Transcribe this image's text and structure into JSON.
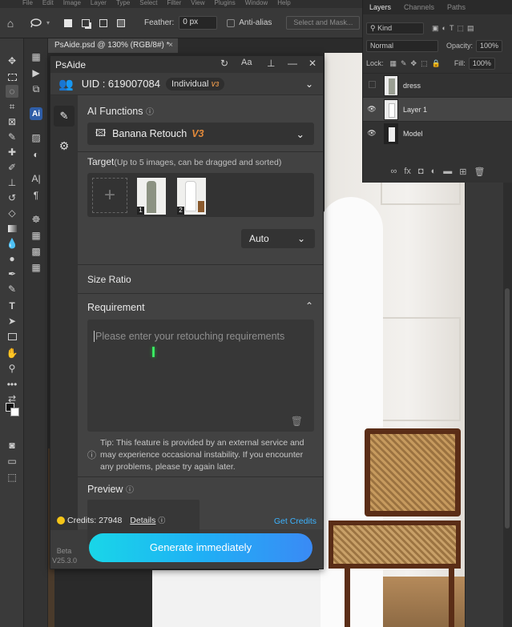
{
  "menubar": {
    "items": [
      "File",
      "Edit",
      "Image",
      "Layer",
      "Type",
      "Select",
      "Filter",
      "View",
      "Plugins",
      "Window",
      "Help"
    ]
  },
  "options": {
    "feather_label": "Feather:",
    "feather_value": "0 px",
    "antialias_label": "Anti-alias",
    "select_mask": "Select and Mask..."
  },
  "document": {
    "tab_title": "PsAide.psd @ 130% (RGB/8#) *"
  },
  "layers_panel": {
    "tabs": [
      "Layers",
      "Channels",
      "Paths"
    ],
    "kind": "Kind",
    "blend": "Normal",
    "opacity_label": "Opacity:",
    "opacity": "100%",
    "lock_label": "Lock:",
    "fill_label": "Fill:",
    "fill": "100%",
    "layers": [
      {
        "name": "dress"
      },
      {
        "name": "Layer 1"
      },
      {
        "name": "Model"
      }
    ]
  },
  "psaide": {
    "title": "PsAide",
    "uid": "UID : 619007084",
    "badge": "Individual",
    "badge_v": "V3",
    "ai_functions_label": "AI Functions",
    "function": "Banana Retouch",
    "function_version": "V3",
    "target_label": "Target",
    "target_hint": "(Up to 5 images, can be dragged and sorted)",
    "target_images": [
      "1",
      "2"
    ],
    "size_ratio_label": "Size Ratio",
    "size_ratio_value": "Auto",
    "requirement_label": "Requirement",
    "requirement_placeholder": "Please enter your retouching requirements",
    "tip": "Tip: This feature is provided by an external service and may experience occasional instability. If you encounter any problems, please try again later.",
    "preview_label": "Preview",
    "credits": "Credits: 27948",
    "details": "Details",
    "get_credits": "Get Credits",
    "beta": "Beta",
    "version": "V25.3.0",
    "generate": "Generate immediately"
  }
}
